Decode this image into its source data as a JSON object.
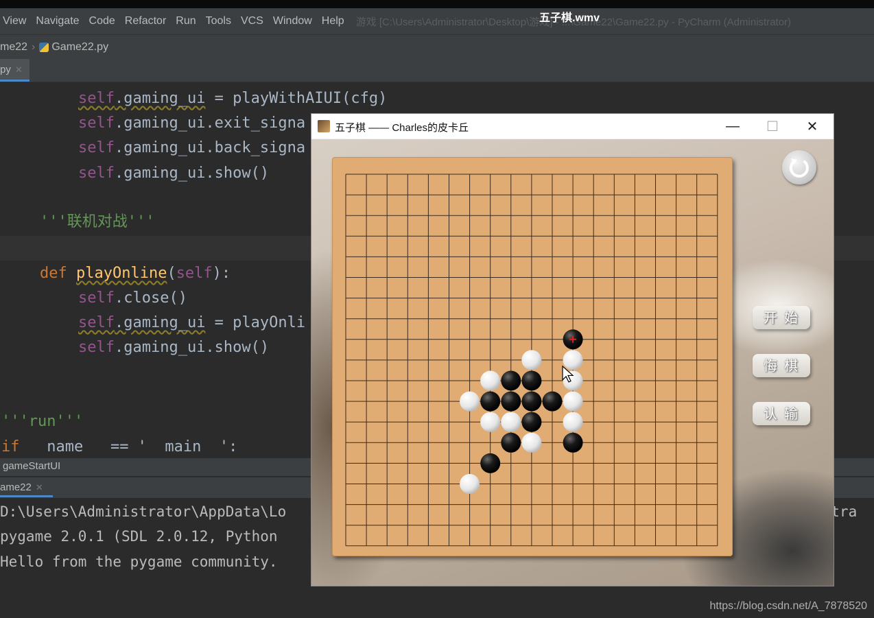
{
  "overlay_title": "五子棋.wmv",
  "menu": [
    "View",
    "Navigate",
    "Code",
    "Refactor",
    "Run",
    "Tools",
    "VCS",
    "Window",
    "Help"
  ],
  "ide_title": "游戏 [C:\\Users\\Administrator\\Desktop\\游戏] - ...\\Game22\\Game22.py - PyCharm (Administrator)",
  "breadcrumb": {
    "project": "me22",
    "file": "Game22.py"
  },
  "editor_tab": {
    "label": "py"
  },
  "code": {
    "l1": {
      "a": "self",
      "b": ".gaming_ui",
      "c": " = playWithAIUI(cfg)"
    },
    "l2": {
      "a": "self",
      "b": ".gaming_ui.exit_signa"
    },
    "l3": {
      "a": "self",
      "b": ".gaming_ui.back_signa"
    },
    "l4": {
      "a": "self",
      "b": ".gaming_ui.show()"
    },
    "l5": {
      "a": "'''",
      "b": "联机对战",
      "c": "'''"
    },
    "l6": {
      "kw": "def ",
      "fn": "playOnline",
      "p1": "(",
      "self": "self",
      "p2": "):"
    },
    "l7": {
      "a": "self",
      "b": ".close()"
    },
    "l8": {
      "a": "self",
      "b": ".gaming_ui",
      "c": " = playOnli"
    },
    "l9": {
      "a": "self",
      "b": ".gaming_ui.show()"
    },
    "l10": {
      "text": "'''run'''"
    },
    "l11": {
      "kw": "if",
      "rest": "   name   == '  main  ':"
    }
  },
  "status_strip": "gameStartUI",
  "run_tab": "ame22",
  "console": {
    "line1": "D:\\Users\\Administrator\\AppData\\Lo",
    "line1_right": "istra",
    "line2": "pygame 2.0.1 (SDL 2.0.12, Python",
    "line3": "Hello from the pygame community."
  },
  "watermark": "https://blog.csdn.net/A_7878520",
  "game_window": {
    "title": "五子棋 —— Charles的皮卡丘",
    "buttons": {
      "start": "开 始",
      "undo": "悔 棋",
      "resign": "认 输"
    },
    "board": {
      "size": 19,
      "black_stones": [
        [
          11,
          8
        ],
        [
          8,
          10
        ],
        [
          9,
          10
        ],
        [
          7,
          11
        ],
        [
          8,
          11
        ],
        [
          9,
          11
        ],
        [
          10,
          11
        ],
        [
          9,
          12
        ],
        [
          8,
          13
        ],
        [
          11,
          13
        ],
        [
          7,
          14
        ]
      ],
      "white_stones": [
        [
          9,
          9
        ],
        [
          11,
          9
        ],
        [
          7,
          10
        ],
        [
          11,
          10
        ],
        [
          6,
          11
        ],
        [
          11,
          11
        ],
        [
          7,
          12
        ],
        [
          8,
          12
        ],
        [
          11,
          12
        ],
        [
          9,
          13
        ],
        [
          6,
          15
        ]
      ],
      "last_move": [
        11,
        8
      ]
    }
  }
}
